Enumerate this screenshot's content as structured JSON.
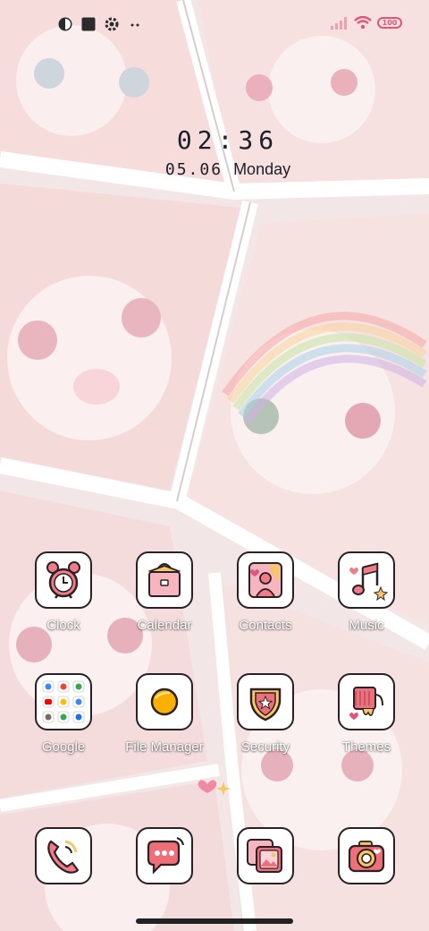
{
  "status_bar": {
    "left_icons": [
      "half-circle-icon",
      "square-icon",
      "gear-icon",
      "more-icon"
    ],
    "right_icons": [
      "signal-icon",
      "wifi-icon",
      "battery-icon"
    ],
    "battery_level": "100",
    "accent_color": "#e0557c"
  },
  "clock": {
    "time": "02:36",
    "date": "05.06",
    "weekday": "Monday"
  },
  "apps": [
    {
      "label": "Clock",
      "icon": "alarm-clock-icon"
    },
    {
      "label": "Calendar",
      "icon": "calendar-bag-icon"
    },
    {
      "label": "Contacts",
      "icon": "contacts-icon"
    },
    {
      "label": "Music",
      "icon": "music-note-icon"
    },
    {
      "label": "Google",
      "icon": "google-folder-icon"
    },
    {
      "label": "File Manager",
      "icon": "egg-folder-icon"
    },
    {
      "label": "Security",
      "icon": "shield-star-icon"
    },
    {
      "label": "Themes",
      "icon": "paint-brush-icon"
    }
  ],
  "dock": [
    {
      "icon": "phone-icon"
    },
    {
      "icon": "messages-icon"
    },
    {
      "icon": "gallery-icon"
    },
    {
      "icon": "camera-icon"
    }
  ]
}
